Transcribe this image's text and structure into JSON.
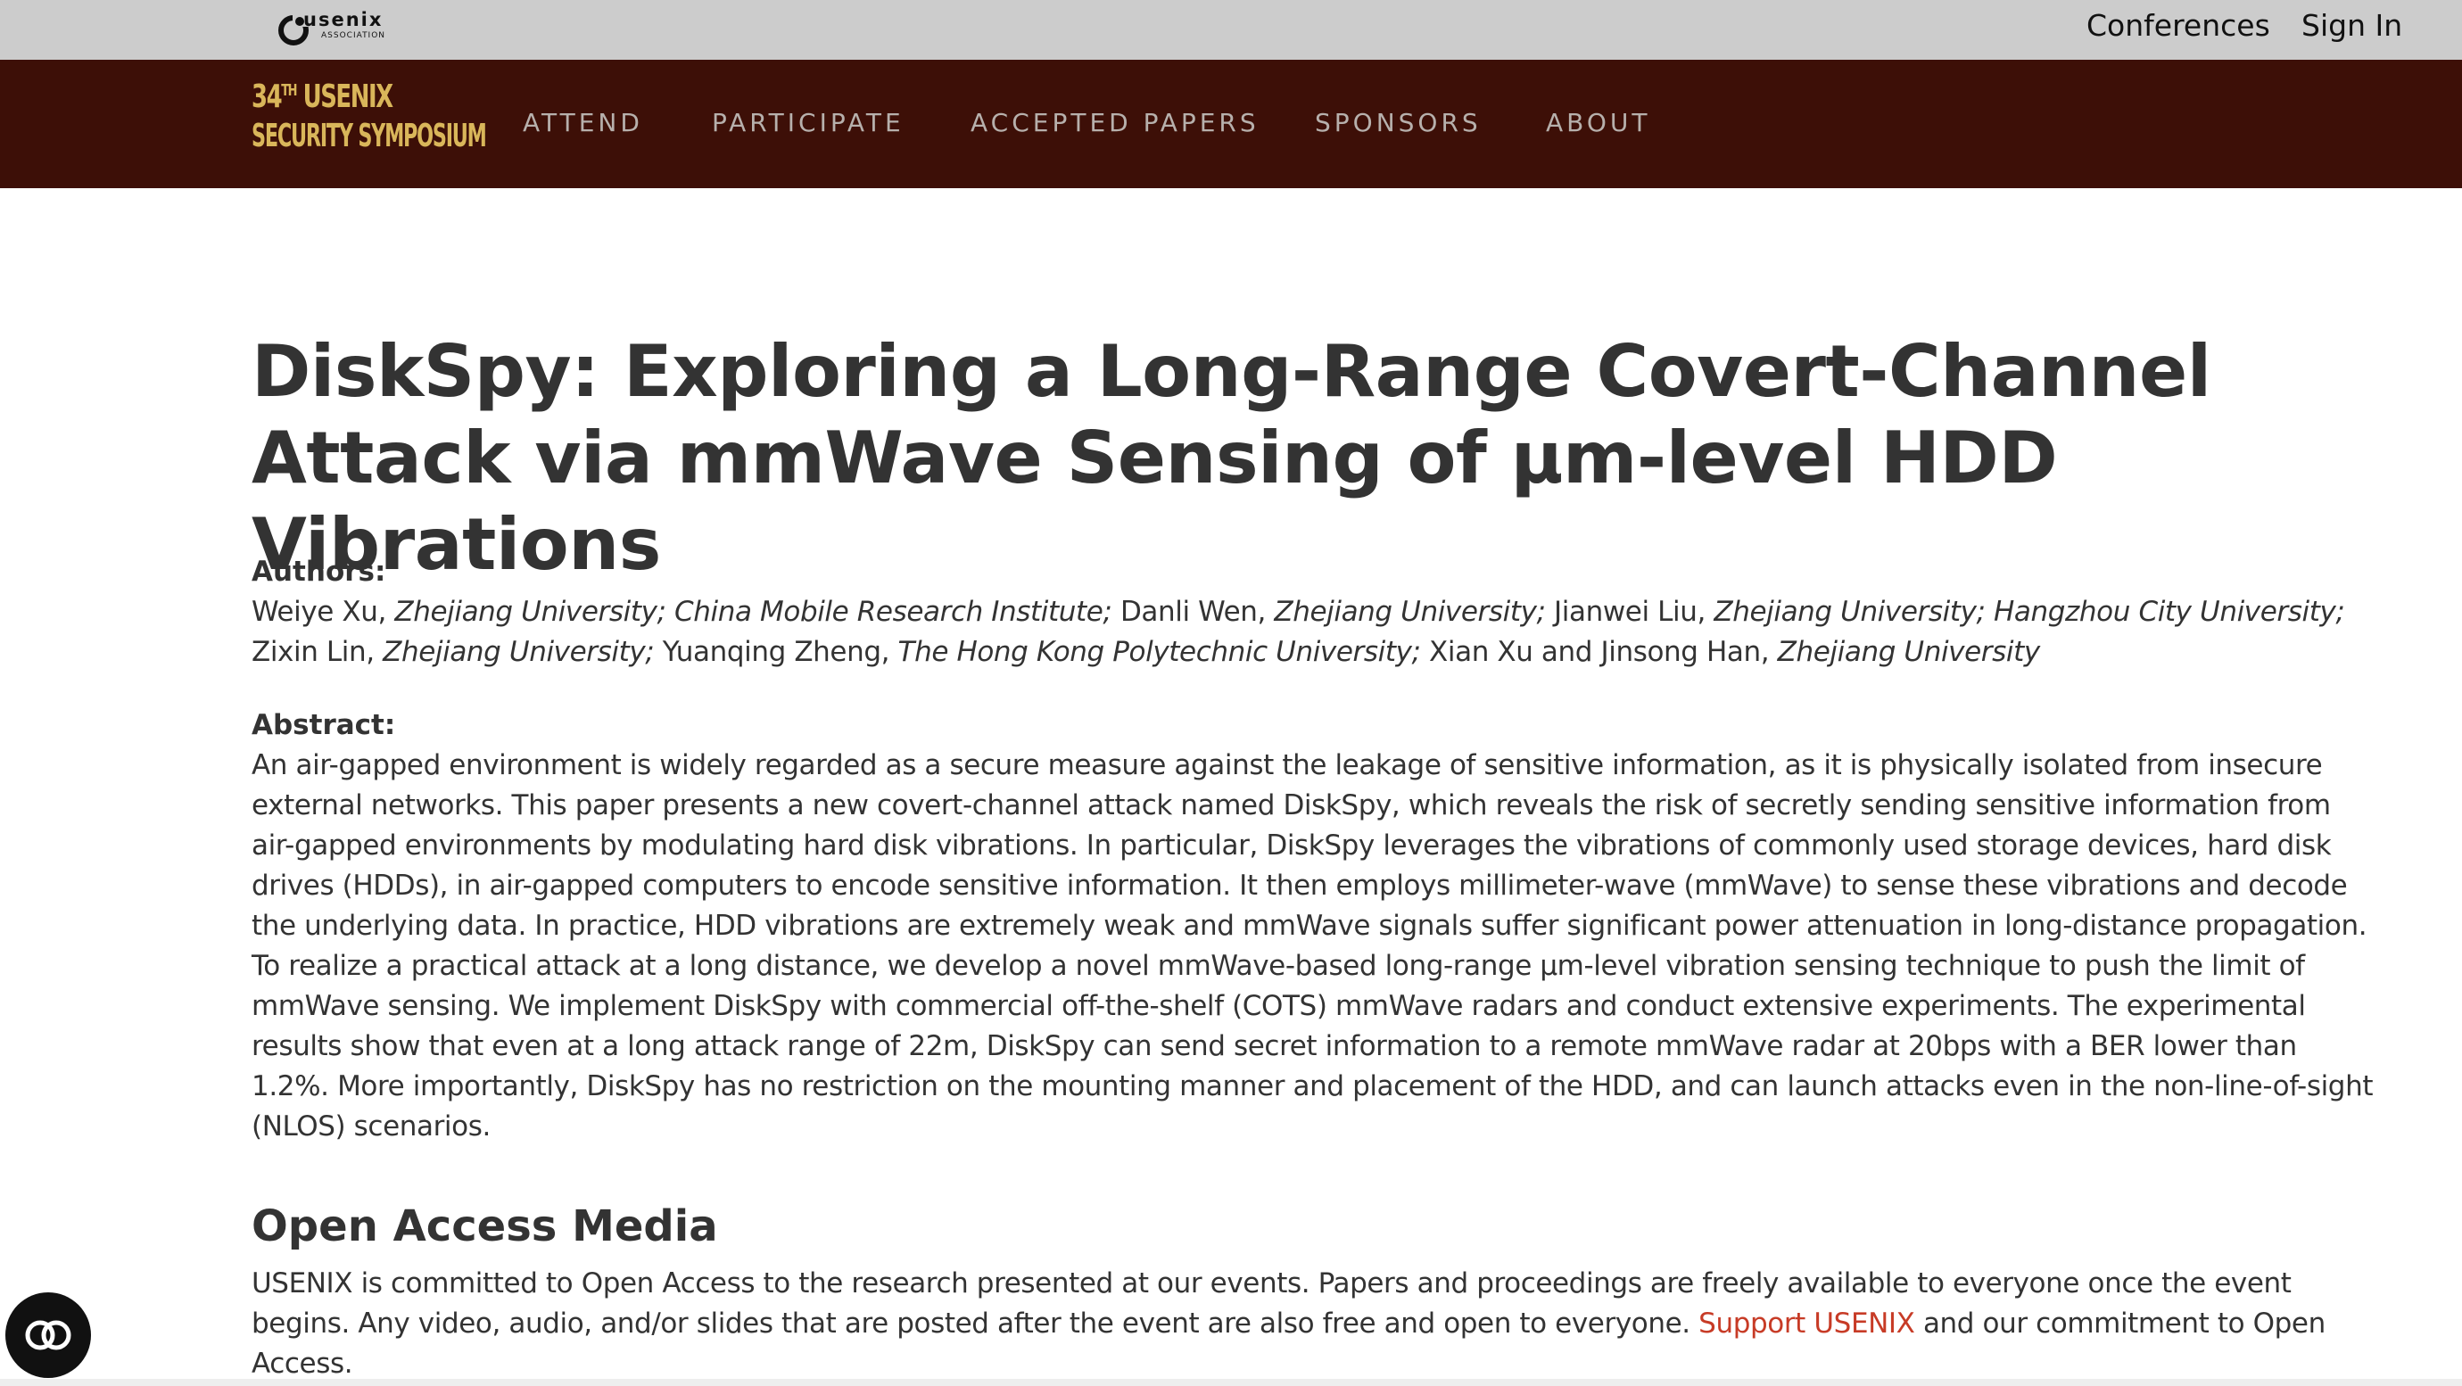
{
  "topbar": {
    "logo_word": "usenix",
    "logo_sub": "ASSOCIATION",
    "conferences": "Conferences",
    "sign_in": "Sign In"
  },
  "symposium_logo": {
    "line1_number": "34",
    "line1_suffix": "TH",
    "line1_rest": " USENIX",
    "line2": "SECURITY SYMPOSIUM"
  },
  "nav": {
    "items": [
      "ATTEND",
      "PARTICIPATE",
      "ACCEPTED PAPERS",
      "SPONSORS",
      "ABOUT"
    ]
  },
  "paper": {
    "title": "DiskSpy: Exploring a Long-Range Covert-Channel Attack via mmWave Sensing of μm-level HDD Vibrations",
    "authors_label": "Authors:",
    "authors": [
      {
        "name": "Weiye Xu, ",
        "aff": "Zhejiang University; China Mobile Research Institute;"
      },
      {
        "name": " Danli Wen, ",
        "aff": "Zhejiang University;"
      },
      {
        "name": " Jianwei Liu, ",
        "aff": "Zhejiang University; Hangzhou City University;"
      },
      {
        "name": " Zixin Lin, ",
        "aff": "Zhejiang University;"
      },
      {
        "name": " Yuanqing Zheng, ",
        "aff": "The Hong Kong Polytechnic University;"
      },
      {
        "name": " Xian Xu and Jinsong Han, ",
        "aff": "Zhejiang University"
      }
    ],
    "abstract_label": "Abstract:",
    "abstract": "An air-gapped environment is widely regarded as a secure measure against the leakage of sensitive information, as it is physically isolated from insecure external networks. This paper presents a new covert-channel attack named DiskSpy, which reveals the risk of secretly sending sensitive information from air-gapped environments by modulating hard disk vibrations. In particular, DiskSpy leverages the vibrations of commonly used storage devices, hard disk drives (HDDs), in air-gapped computers to encode sensitive information. It then employs millimeter-wave (mmWave) to sense these vibrations and decode the underlying data. In practice, HDD vibrations are extremely weak and mmWave signals suffer significant power attenuation in long-distance propagation. To realize a practical attack at a long distance, we develop a novel mmWave-based long-range μm-level vibration sensing technique to push the limit of mmWave sensing. We implement DiskSpy with commercial off-the-shelf (COTS) mmWave radars and conduct extensive experiments. The experimental results show that even at a long attack range of 22m, DiskSpy can send secret information to a remote mmWave radar at 20bps with a BER lower than 1.2%. More importantly, DiskSpy has no restriction on the mounting manner and placement of the HDD, and can launch attacks even in the non-line-of-sight (NLOS) scenarios."
  },
  "open_access": {
    "heading": "Open Access Media",
    "text_before": "USENIX is committed to Open Access to the research presented at our events. Papers and proceedings are freely available to everyone once the event begins. Any video, audio, and/or slides that are posted after the event are also free and open to everyone. ",
    "link": "Support USENIX",
    "text_after": " and our commitment to Open Access."
  },
  "colors": {
    "topbar_bg": "#cccccc",
    "navbar_bg": "#3d0f07",
    "logo_gold": "#d9b65a",
    "link_red": "#c73b26"
  },
  "icons": {
    "usenix_logo": "usenix-logo-icon",
    "accessibility": "accessibility-icon"
  }
}
